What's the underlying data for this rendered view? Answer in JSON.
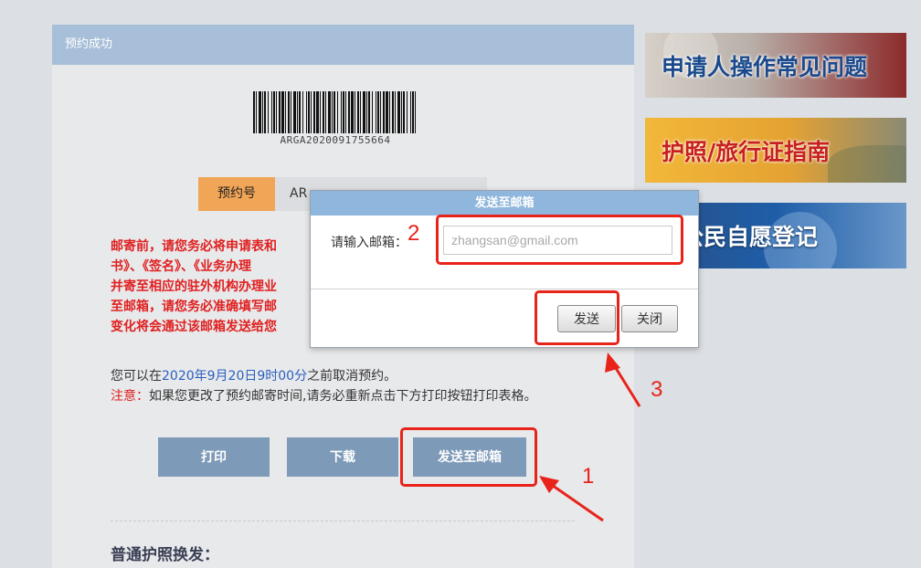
{
  "panel": {
    "header_title": "预约成功"
  },
  "barcode": {
    "code": "ARGA2020091755664"
  },
  "reservation": {
    "tag_label": "预约号",
    "value_visible": "AR"
  },
  "warning": {
    "lines": [
      "邮寄前，请您务必将申请表和",
      "书》、《签名》、《业务办理",
      "并寄至相应的驻外机构办理业",
      "至邮箱，请您务必准确填写邮",
      "变化将会通过该邮箱发送给您"
    ]
  },
  "cancel_info": {
    "prefix": "您可以在",
    "date": "2020年9月20日9时00分",
    "suffix": "之前取消预约。",
    "note_label": "注意：",
    "note_text": "如果您更改了预约邮寄时间,请务必重新点击下方打印按钮打印表格。"
  },
  "actions": {
    "print_label": "打印",
    "download_label": "下载",
    "email_label": "发送至邮箱"
  },
  "section": {
    "title": "普通护照换发："
  },
  "side_banners": [
    {
      "text": "申请人操作常见问题"
    },
    {
      "text": "护照/旅行证指南"
    },
    {
      "text": "外公民自愿登记"
    }
  ],
  "dialog": {
    "title": "发送至邮箱",
    "label": "请输入邮箱：",
    "placeholder": "zhangsan@gmail.com",
    "send_label": "发送",
    "close_label": "关闭"
  },
  "annotations": {
    "step1": "1",
    "step2": "2",
    "step3": "3"
  },
  "colors": {
    "accent_red": "#e8231a",
    "header_blue": "#a7bfd8",
    "button_blue": "#7d9ab8",
    "tag_orange": "#f1a557"
  }
}
